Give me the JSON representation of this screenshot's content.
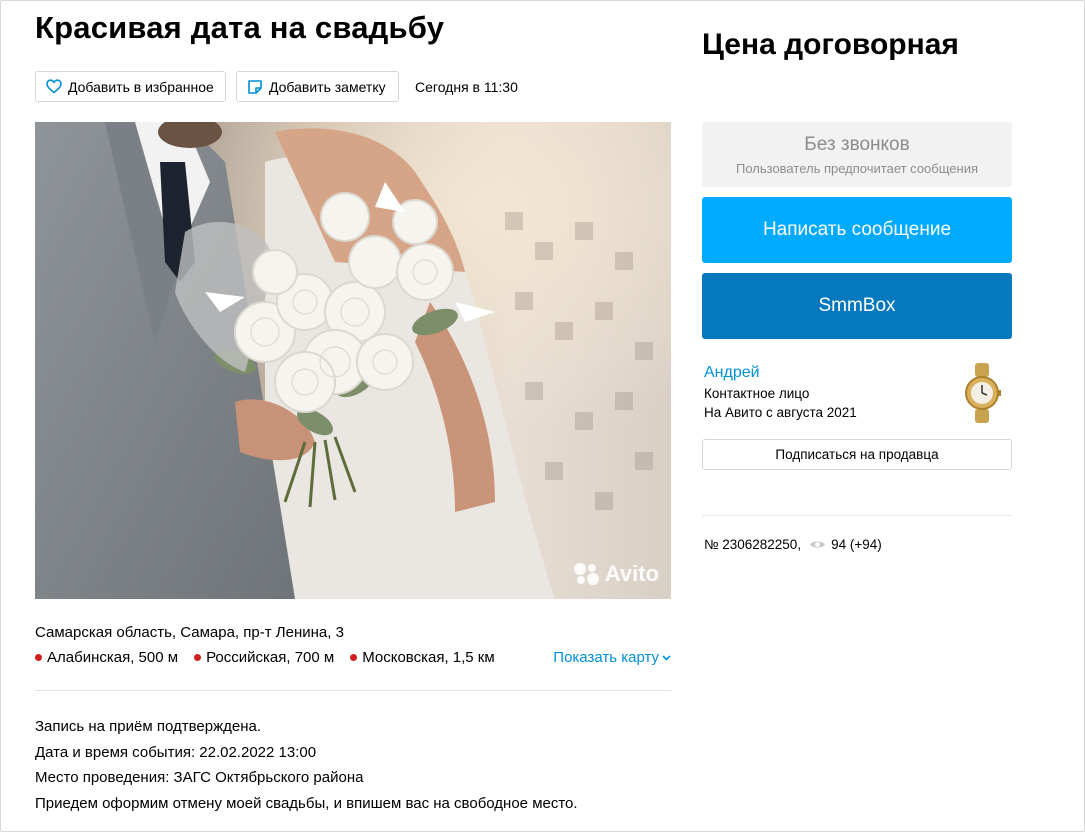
{
  "listing": {
    "title": "Красивая дата на свадьбу",
    "favorite_label": "Добавить в избранное",
    "note_label": "Добавить заметку",
    "posted": "Сегодня в 11:30",
    "watermark": "Avito",
    "address": "Самарская область, Самара, пр-т Ленина, 3",
    "metros": [
      {
        "name": "Алабинская, 500 м"
      },
      {
        "name": "Российская, 700 м"
      },
      {
        "name": "Московская, 1,5 км"
      }
    ],
    "map_link": "Показать карту",
    "description": [
      "Запись на приём подтверждена.",
      "Дата и время события: 22.02.2022 13:00",
      "Место проведения: ЗАГС Октябрьского района",
      "Приедем оформим отмену моей свадьбы, и впишем вас на свободное место."
    ]
  },
  "sidebar": {
    "price": "Цена договорная",
    "no_calls_title": "Без звонков",
    "no_calls_subtitle": "Пользователь предпочитает сообщения",
    "message_button": "Написать сообщение",
    "smmbox_button": "SmmBox",
    "seller_name": "Андрей",
    "seller_role": "Контактное лицо",
    "seller_since": "На Авито с августа 2021",
    "subscribe_button": "Подписаться на продавца",
    "ad_number": "№ 2306282250,",
    "views": "94 (+94)"
  },
  "colors": {
    "accent": "#00aaff",
    "smmbox": "#0678be",
    "link": "#0091d9",
    "metro_dot": "#d11f1f"
  },
  "icons": [
    "heart-icon",
    "note-icon",
    "chevron-down-icon",
    "eye-icon",
    "avito-logo-icon"
  ]
}
